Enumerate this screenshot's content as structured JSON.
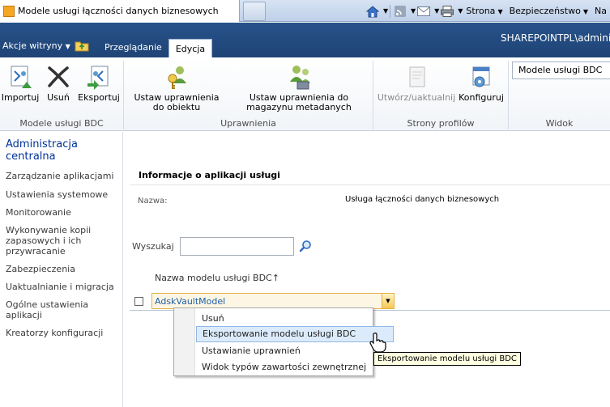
{
  "browser": {
    "tab_title": "Modele usługi łączności danych biznesowych",
    "toolbar": {
      "strona": "Strona",
      "bezpieczenstwo": "Bezpieczeństwo",
      "more": "Na"
    }
  },
  "ribbon": {
    "site_actions": "Akcje witryny",
    "tabs": [
      {
        "label": "Przeglądanie"
      },
      {
        "label": "Edycja"
      }
    ],
    "user": "SHAREPOINTPL\\adminis",
    "groups": {
      "bdc_models": {
        "label": "Modele usługi BDC",
        "buttons": [
          {
            "label": "Importuj"
          },
          {
            "label": "Usuń"
          },
          {
            "label": "Eksportuj"
          }
        ]
      },
      "permissions": {
        "label": "Uprawnienia",
        "buttons": [
          {
            "label": "Ustaw uprawnienia do obiektu"
          },
          {
            "label": "Ustaw uprawnienia do magazynu metadanych"
          }
        ]
      },
      "profile_pages": {
        "label": "Strony profilów",
        "buttons": [
          {
            "label": "Utwórz/uaktualnij"
          },
          {
            "label": "Konfiguruj"
          }
        ]
      },
      "view": {
        "label": "Widok",
        "selected": "Modele usługi BDC"
      }
    }
  },
  "nav": {
    "title": "Administracja centralna",
    "items": [
      "Zarządzanie aplikacjami",
      "Ustawienia systemowe",
      "Monitorowanie",
      "Wykonywanie kopii zapasowych i ich przywracanie",
      "Zabezpieczenia",
      "Uaktualnianie i migracja",
      "Ogólne ustawienia aplikacji",
      "Kreatorzy konfiguracji"
    ]
  },
  "main": {
    "info_title": "Informacje o aplikacji usługi",
    "name_label": "Nazwa:",
    "name_value": "Usługa łączności danych biznesowych",
    "search_label": "Wyszukaj",
    "search_value": "",
    "column_header": "Nazwa modelu usługi BDC↑",
    "rows": [
      {
        "name": "AdskVaultModel"
      }
    ]
  },
  "context_menu": {
    "items": [
      "Usuń",
      "Eksportowanie modelu usługi BDC",
      "Ustawianie uprawnień",
      "Widok typów zawartości zewnętrznej"
    ],
    "highlighted_index": 1
  },
  "tooltip": "Eksportowanie modelu usługi BDC",
  "colors": {
    "ribbon_dark": "#1f4476",
    "link": "#1d5ea8",
    "nav_title": "#003399",
    "highlight": "#dcebfb"
  }
}
